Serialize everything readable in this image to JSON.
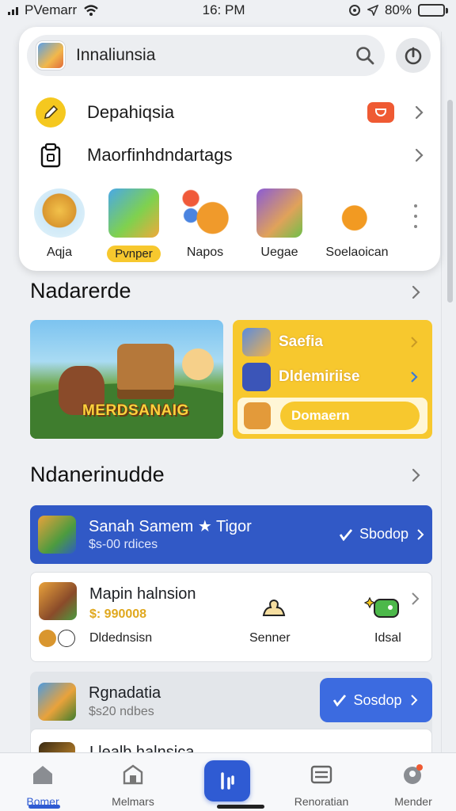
{
  "status_bar": {
    "carrier": "PVemarr",
    "time": "16: PM",
    "battery": "80%",
    "battery_level": 0.8
  },
  "search": {
    "text": "Innaliunsia"
  },
  "menu": [
    {
      "label": "Depahiqsia"
    },
    {
      "label": "Maorfinhdndartags"
    }
  ],
  "shortcuts": [
    {
      "label": "Aqja"
    },
    {
      "label": "Pvnper"
    },
    {
      "label": "Napos"
    },
    {
      "label": "Uegae"
    },
    {
      "label": "Soelaoican"
    }
  ],
  "sections": {
    "first_title": "Nadarerde",
    "second_title": "Ndanerinudde"
  },
  "banner": {
    "logo_text": "MERDSANAIG"
  },
  "promo": {
    "item1": "Saefia",
    "item2": "Dldemiriise",
    "pill": "Domaern"
  },
  "rows": {
    "blue": {
      "title": "Sanah Samem ★ Tigor",
      "subtitle": "$s-00 rdices",
      "button": "Sbodop"
    },
    "white": {
      "title": "Mapin halnsion",
      "price": "$: 990008",
      "sub": "Dldednsisn",
      "mid": "Senner",
      "right": "Idsal"
    },
    "grey": {
      "title": "Rgnadatia",
      "subtitle": "$s20 ndbes",
      "button": "Sosdop"
    },
    "partial": {
      "title": "Llealb halnsica"
    }
  },
  "tabs": [
    {
      "label": "Bomer"
    },
    {
      "label": "Melmars"
    },
    {
      "label": ""
    },
    {
      "label": "Renoratian"
    },
    {
      "label": "Mender"
    }
  ],
  "colors": {
    "accent": "#2f5bd3",
    "promo_yellow": "#f7c82e",
    "badge_red": "#ef5a33",
    "row_blue": "#3159c6"
  }
}
